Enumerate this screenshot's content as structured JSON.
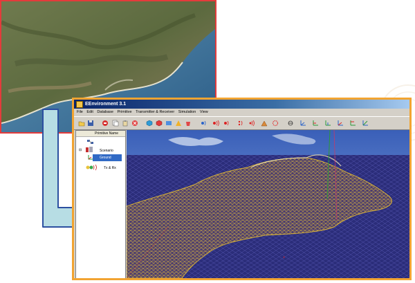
{
  "window": {
    "title": "EEnvironment 3.1"
  },
  "menu": [
    "File",
    "Edit",
    "Database",
    "Primitive",
    "Transmitter & Receiver",
    "Simulation",
    "View"
  ],
  "tree": {
    "header": "Primitive Name",
    "items": [
      {
        "label": "Scenario",
        "icon": "scenario-icon"
      },
      {
        "label": "Ground",
        "icon": "ground-icon",
        "selected": true
      },
      {
        "label": "Tx & Rx",
        "icon": "antenna-icon"
      }
    ]
  },
  "toolbar_icons": [
    "open-icon",
    "save-icon",
    "stop-icon",
    "copy-icon",
    "paste-icon",
    "delete-icon",
    "cube-icon",
    "red-cube-icon",
    "plane-icon",
    "cone-icon",
    "red-object-icon",
    "transmitter-icon",
    "receiver-icon",
    "wave-icon",
    "grid-icon",
    "ray-icon",
    "sphere-icon",
    "axis-icon",
    "axis-icon",
    "axis-icon",
    "axis-icon",
    "axis-icon",
    "axis-icon"
  ],
  "colors": {
    "photo_border": "#e43b3b",
    "window_border": "#f2a431",
    "arrow_fill": "#b7dde4",
    "arrow_stroke": "#2b4fa0",
    "sky": "#4a6fc0",
    "sea": "#2b2d7a",
    "mesh": "#d8b238"
  }
}
